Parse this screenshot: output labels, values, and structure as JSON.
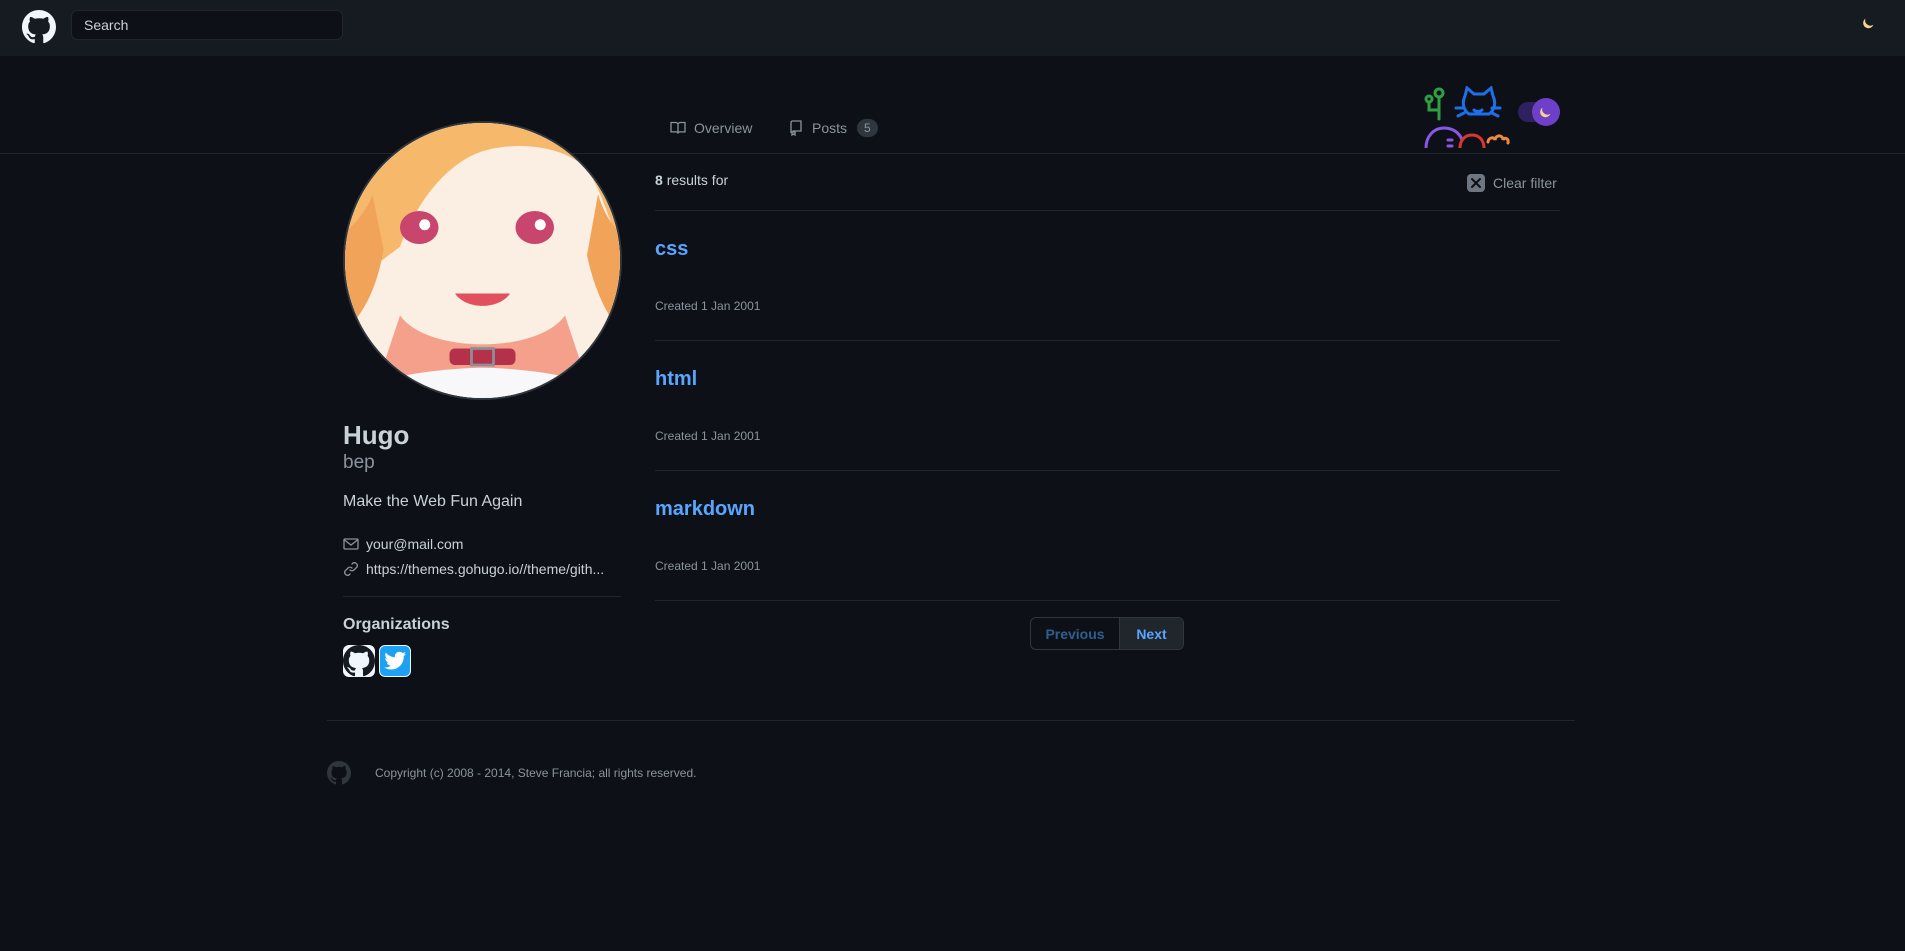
{
  "header": {
    "logo": "github-icon",
    "search_placeholder": "Search",
    "theme_icon": "moon-icon"
  },
  "tabs": [
    {
      "label": "Overview",
      "icon": "book-icon"
    },
    {
      "label": "Posts",
      "icon": "repo-icon",
      "count": "5"
    }
  ],
  "profile": {
    "name": "Hugo",
    "login": "bep",
    "bio": "Make the Web Fun Again",
    "email": "your@mail.com",
    "website": "https://themes.gohugo.io//theme/gith...",
    "organizations_title": "Organizations",
    "organizations": [
      {
        "name": "github",
        "icon": "github-icon"
      },
      {
        "name": "twitter",
        "icon": "twitter-icon"
      }
    ]
  },
  "results": {
    "count": "8",
    "label": "results for",
    "clear_filter": "Clear filter",
    "posts": [
      {
        "title": "css",
        "date": "Created 1 Jan 2001"
      },
      {
        "title": "html",
        "date": "Created 1 Jan 2001"
      },
      {
        "title": "markdown",
        "date": "Created 1 Jan 2001"
      }
    ]
  },
  "pagination": {
    "previous": "Previous",
    "next": "Next"
  },
  "footer": {
    "copyright": "Copyright (c) 2008 - 2014, Steve Francia; all rights reserved."
  },
  "colors": {
    "background": "#0d1117",
    "header": "#161b22",
    "accent": "#58a6ff",
    "toggle": "#6e40c9"
  }
}
